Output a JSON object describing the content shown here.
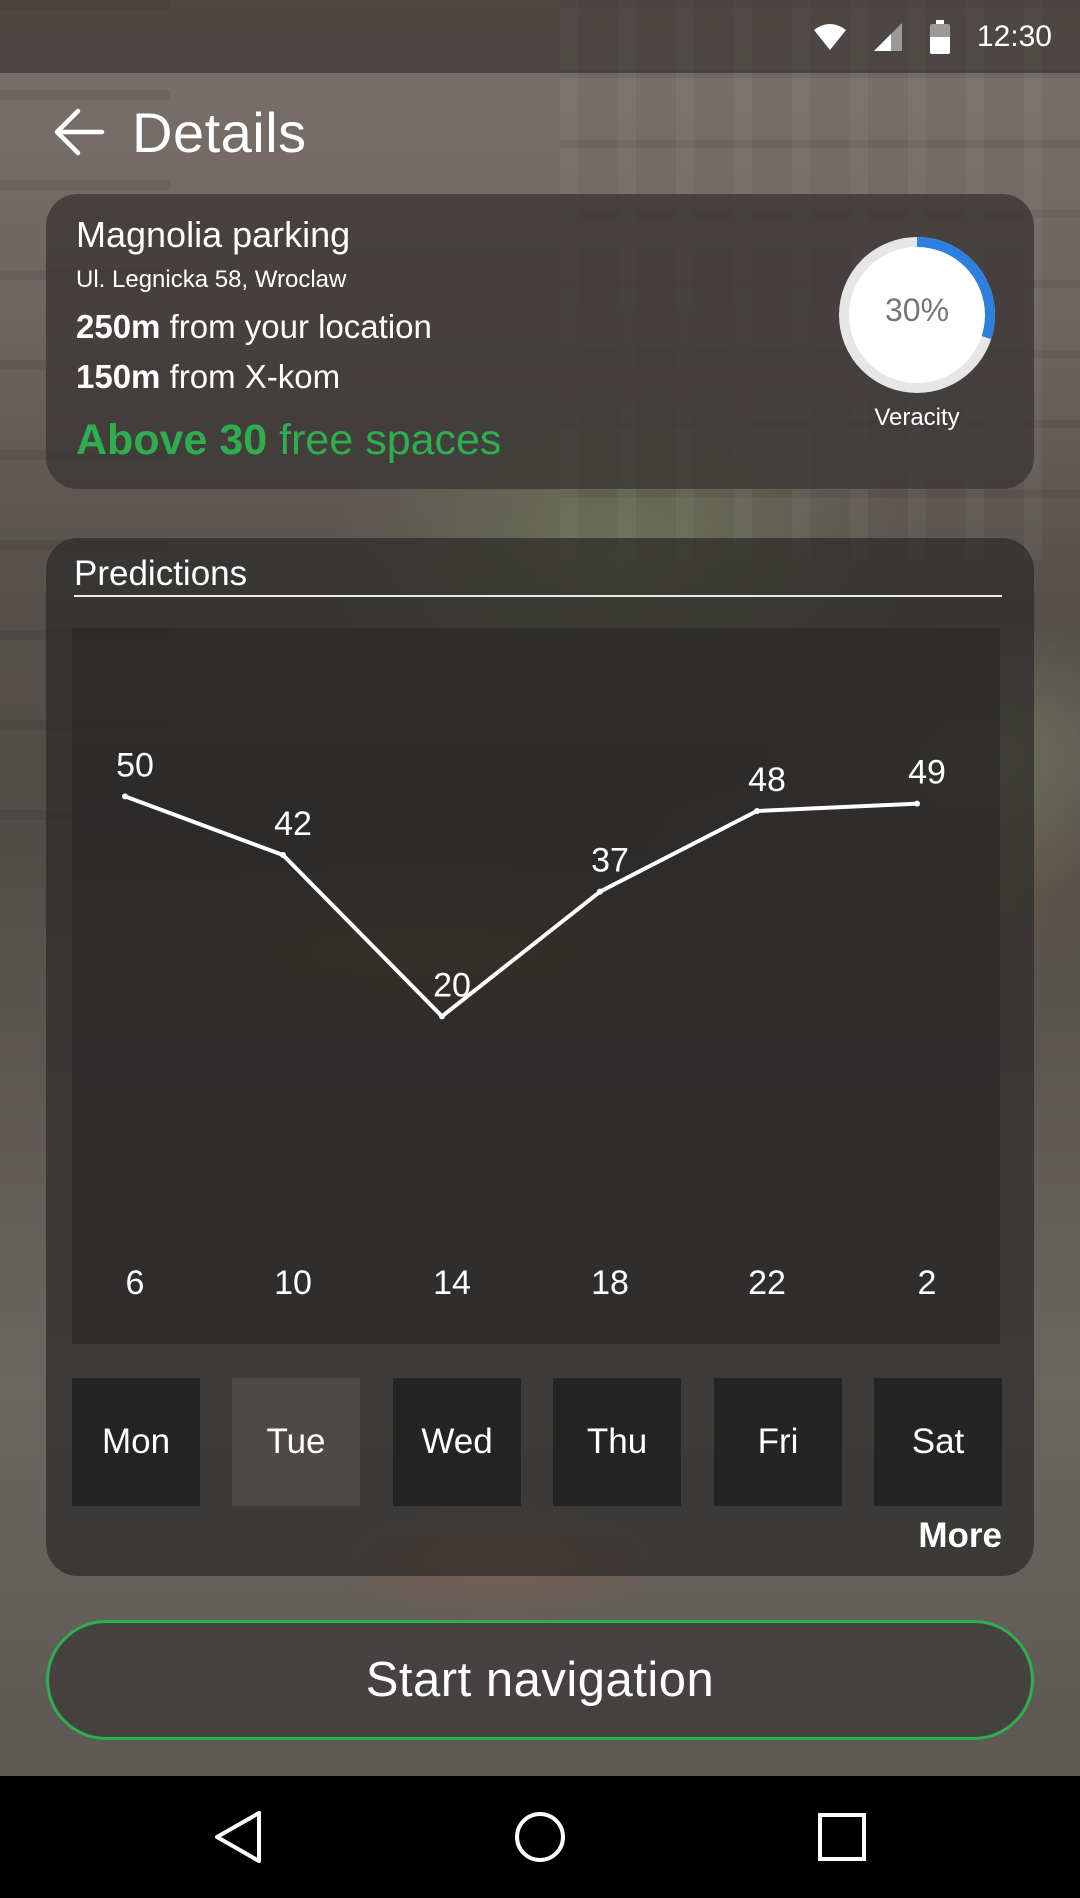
{
  "status_bar": {
    "time": "12:30",
    "battery_level": 0.55,
    "icons": [
      "wifi-icon",
      "cell-signal-icon",
      "battery-icon"
    ]
  },
  "header": {
    "title": "Details",
    "back_icon": "arrow-left-icon"
  },
  "info": {
    "name": "Magnolia parking",
    "address": "Ul. Legnicka 58, Wroclaw",
    "distance_location_value": "250m",
    "distance_location_text": " from your location",
    "distance_poi_value": "150m",
    "distance_poi_text": " from X-kom",
    "free_spaces_bold": "Above 30",
    "free_spaces_text": " free spaces",
    "veracity_percent": 30,
    "veracity_text": "30%",
    "veracity_label": "Veracity"
  },
  "predictions": {
    "title": "Predictions",
    "days": [
      "Mon",
      "Tue",
      "Wed",
      "Thu",
      "Fri",
      "Sat"
    ],
    "more_label": "More"
  },
  "chart_data": {
    "type": "line",
    "x": [
      "6",
      "10",
      "14",
      "18",
      "22",
      "2"
    ],
    "series": [
      {
        "values": [
          50,
          42,
          20,
          37,
          48,
          49
        ]
      }
    ],
    "ylim": [
      0,
      60
    ]
  },
  "actions": {
    "start_navigation_label": "Start navigation"
  },
  "system_nav": {
    "buttons": [
      "back-triangle-icon",
      "home-circle-icon",
      "recents-square-icon"
    ]
  },
  "colors": {
    "accent_green": "#2fae4f",
    "gauge_blue": "#2d7fe0",
    "gauge_track": "#e6e6e6"
  }
}
